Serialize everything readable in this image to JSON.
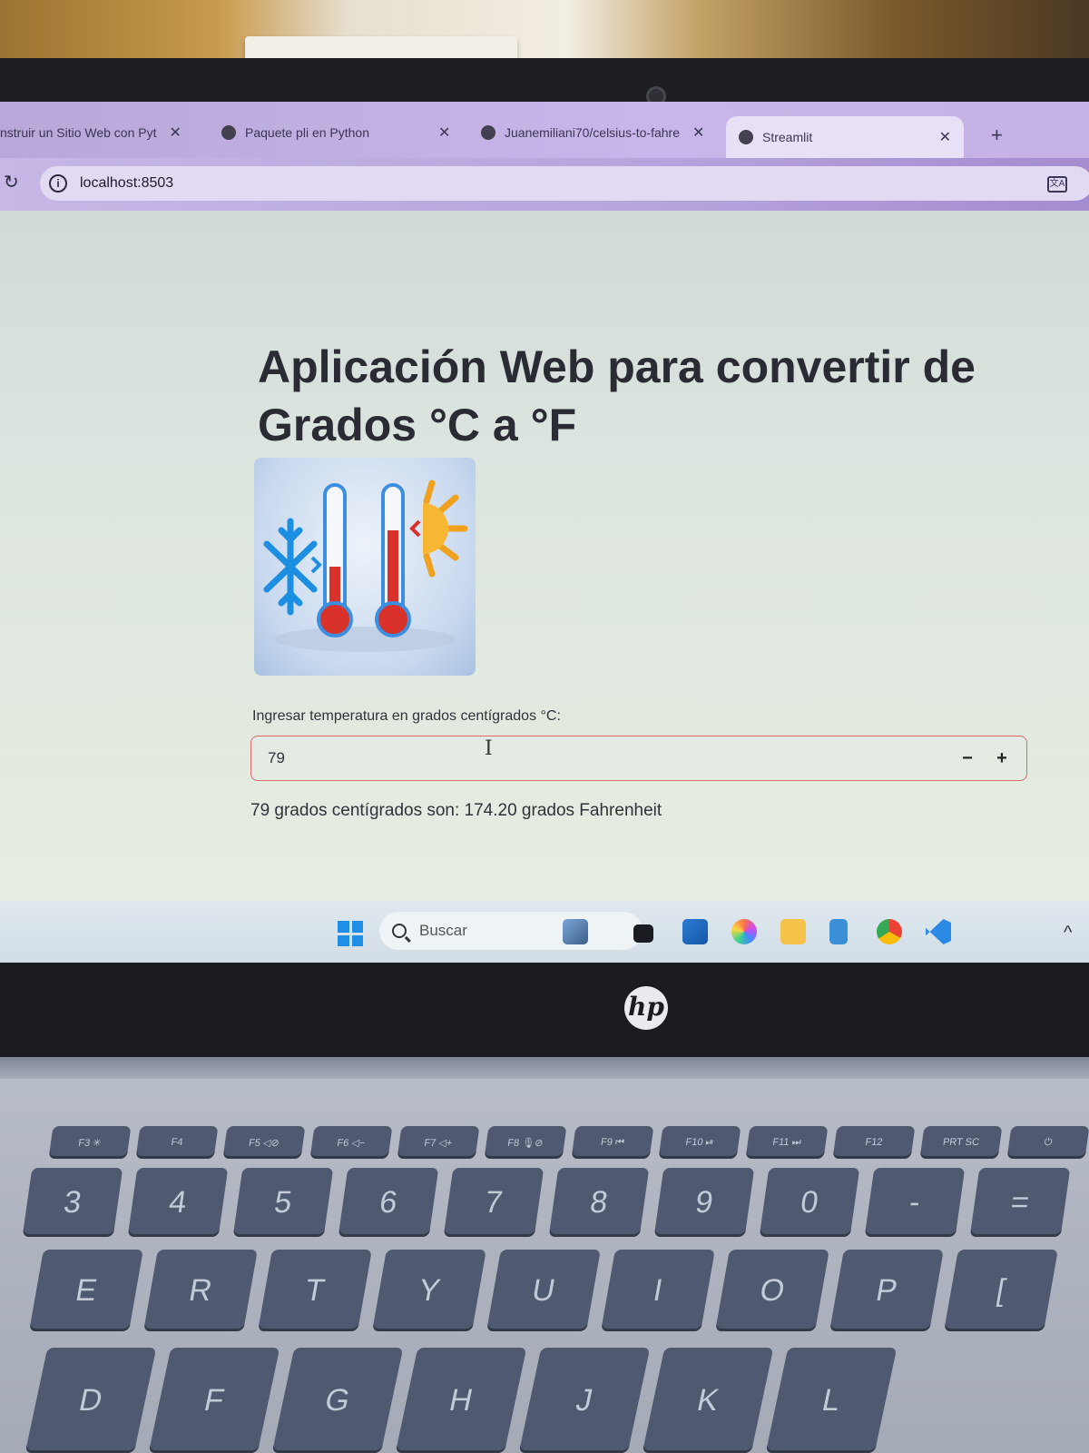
{
  "browser": {
    "tabs": [
      {
        "title": "nstruir un Sitio Web con Pyt",
        "active": false
      },
      {
        "title": "Paquete pli en Python",
        "active": false
      },
      {
        "title": "Juanemiliani70/celsius-to-fahre",
        "active": false
      },
      {
        "title": "Streamlit",
        "active": true
      }
    ],
    "address": "localhost:8503",
    "icons": {
      "reload": "reload-icon",
      "info": "info-icon",
      "translate": "translate-icon"
    }
  },
  "app": {
    "title": "Aplicación Web para convertir de Grados °C a °F",
    "input_label": "Ingresar temperatura en grados centígrados °C:",
    "input_value": "79",
    "minus_label": "−",
    "plus_label": "+",
    "result": "79 grados centígrados son: 174.20 grados Fahrenheit",
    "image": "thermometers-snowflake-sun"
  },
  "taskbar": {
    "search_placeholder": "Buscar",
    "icons": [
      "windows-start-icon",
      "search-icon",
      "widgets-icon",
      "task-view-icon",
      "store-icon",
      "copilot-icon",
      "file-explorer-icon",
      "notepad-icon",
      "chrome-icon",
      "vscode-icon"
    ]
  },
  "laptop": {
    "brand": "hp"
  },
  "keyboard": {
    "function_row": [
      "F3 ✳",
      "F4",
      "F5 ◁⊘",
      "F6 ◁−",
      "F7 ◁+",
      "F8 🎙⊘",
      "F9 ⏮",
      "F10 ⏯",
      "F11 ⏭",
      "F12",
      "PRT SC",
      "⏻"
    ],
    "number_row": [
      "3",
      "4",
      "5",
      "6",
      "7",
      "8",
      "9",
      "0",
      "-",
      "="
    ],
    "top_row": [
      "E",
      "R",
      "T",
      "Y",
      "U",
      "I",
      "O",
      "P",
      "["
    ],
    "home_row": [
      "D",
      "F",
      "G",
      "H",
      "J",
      "K",
      "L"
    ]
  },
  "colors": {
    "input_border": "#e06a6a",
    "tab_bar": "#c8b6ea",
    "key": "#4f5a70"
  }
}
